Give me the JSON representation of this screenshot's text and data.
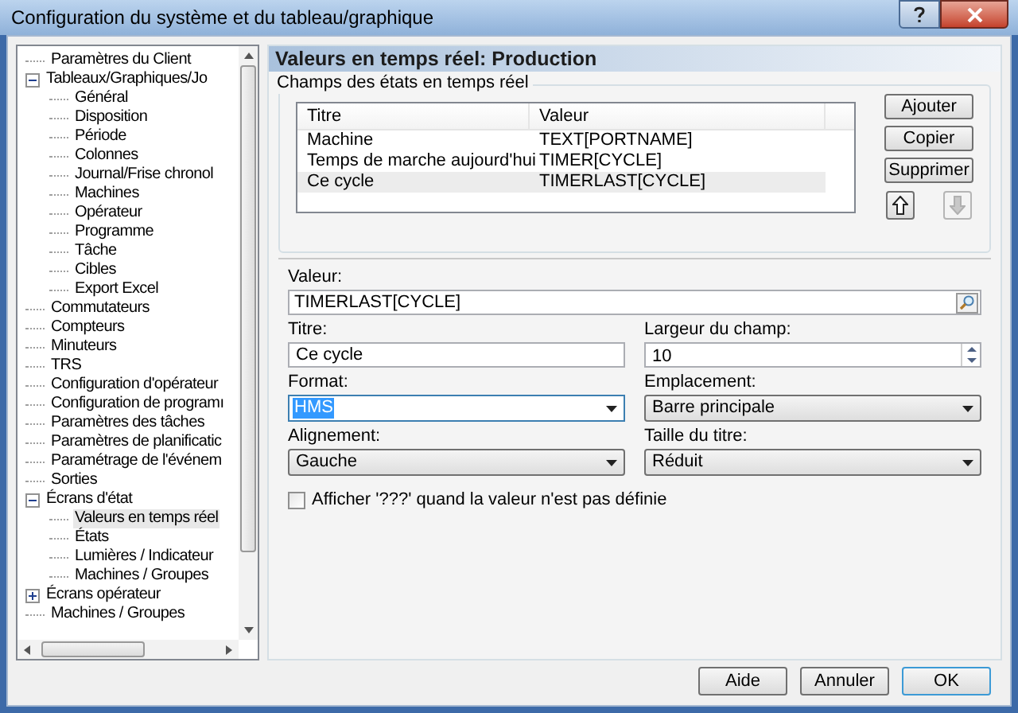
{
  "window": {
    "title": "Configuration du système et du tableau/graphique"
  },
  "tree": [
    {
      "label": "Paramètres du Client",
      "selected": false
    },
    {
      "label": "Tableaux/Graphiques/Jo",
      "selected": false,
      "expanded": true,
      "children": [
        {
          "label": "Général",
          "selected": false
        },
        {
          "label": "Disposition",
          "selected": false
        },
        {
          "label": "Période",
          "selected": false
        },
        {
          "label": "Colonnes",
          "selected": false
        },
        {
          "label": "Journal/Frise chronol",
          "selected": false
        },
        {
          "label": "Machines",
          "selected": false
        },
        {
          "label": "Opérateur",
          "selected": false
        },
        {
          "label": "Programme",
          "selected": false
        },
        {
          "label": "Tâche",
          "selected": false
        },
        {
          "label": "Cibles",
          "selected": false
        },
        {
          "label": "Export Excel",
          "selected": false
        }
      ]
    },
    {
      "label": "Commutateurs",
      "selected": false
    },
    {
      "label": "Compteurs",
      "selected": false
    },
    {
      "label": "Minuteurs",
      "selected": false
    },
    {
      "label": "TRS",
      "selected": false
    },
    {
      "label": "Configuration d'opérateur",
      "selected": false
    },
    {
      "label": "Configuration de programı",
      "selected": false
    },
    {
      "label": "Paramètres des tâches",
      "selected": false
    },
    {
      "label": "Paramètres de planificatic",
      "selected": false
    },
    {
      "label": "Paramétrage de l'événem",
      "selected": false
    },
    {
      "label": "Sorties",
      "selected": false
    },
    {
      "label": "Écrans d'état",
      "selected": false,
      "expanded": true,
      "children": [
        {
          "label": "Valeurs en temps réel",
          "selected": true
        },
        {
          "label": "États",
          "selected": false
        },
        {
          "label": "Lumières / Indicateur",
          "selected": false
        },
        {
          "label": "Machines / Groupes",
          "selected": false
        }
      ]
    },
    {
      "label": "Écrans opérateur",
      "selected": false,
      "expanded": false
    },
    {
      "label": "Machines / Groupes",
      "selected": false
    }
  ],
  "panel": {
    "title": "Valeurs en temps réel: Production",
    "group_title": "Champs des états en temps réel",
    "list": {
      "columns": [
        "Titre",
        "Valeur"
      ],
      "rows": [
        {
          "cells": [
            "Machine",
            "TEXT[PORTNAME]"
          ],
          "selected": false
        },
        {
          "cells": [
            "Temps de marche aujourd'hui",
            "TIMER[CYCLE]"
          ],
          "selected": false
        },
        {
          "cells": [
            "Ce cycle",
            "TIMERLAST[CYCLE]"
          ],
          "selected": true
        }
      ]
    },
    "list_buttons": [
      "Ajouter",
      "Copier",
      "Supprimer"
    ],
    "move_up": {
      "disabled": false
    },
    "move_down": {
      "disabled": true
    },
    "value": {
      "label": "Valeur:",
      "value": "TIMERLAST[CYCLE]"
    },
    "fields": [
      {
        "kind": "text",
        "label": "Titre:",
        "value": "Ce cycle",
        "focused": false
      },
      {
        "kind": "spin",
        "label": "Largeur du champ:",
        "value": "10",
        "focused": false
      },
      {
        "kind": "combo",
        "label": "Format:",
        "value": "HMS",
        "focused": true
      },
      {
        "kind": "select",
        "label": "Emplacement:",
        "value": "Barre principale",
        "focused": false
      },
      {
        "kind": "select",
        "label": "Alignement:",
        "value": "Gauche",
        "focused": false
      },
      {
        "kind": "select",
        "label": "Taille du titre:",
        "value": "Réduit",
        "focused": false
      }
    ],
    "checkbox": {
      "label": "Afficher '???' quand la valeur n'est pas définie",
      "checked": false
    }
  },
  "buttons": [
    {
      "label": "Aide",
      "default": false
    },
    {
      "label": "Annuler",
      "default": false
    },
    {
      "label": "OK",
      "default": true
    }
  ]
}
